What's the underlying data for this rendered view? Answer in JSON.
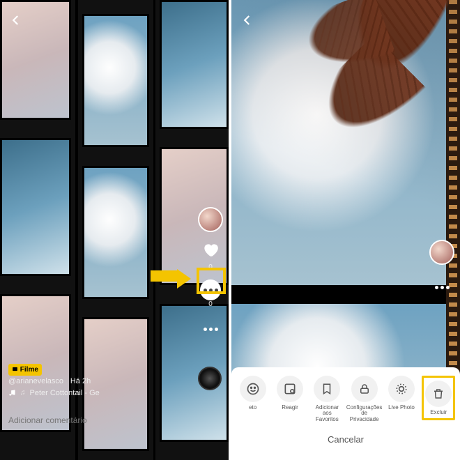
{
  "left": {
    "badge": "Filme",
    "username": "@arianevelasco",
    "time": "Há 2h",
    "music": "Peter Cottontail - Ge",
    "comment_placeholder": "Adicionar comentário",
    "like_count": "0",
    "comment_count": "0"
  },
  "right": {
    "sheet": {
      "items": [
        {
          "key": "eto",
          "label": "eto"
        },
        {
          "key": "reagir",
          "label": "Reagir"
        },
        {
          "key": "favoritos",
          "label": "Adicionar aos Favoritos"
        },
        {
          "key": "privacidade",
          "label": "Configurações de Privacidade"
        },
        {
          "key": "livephoto",
          "label": "Live Photo"
        },
        {
          "key": "excluir",
          "label": "Excluir"
        }
      ],
      "cancel": "Cancelar"
    }
  },
  "colors": {
    "highlight": "#f4c400"
  }
}
